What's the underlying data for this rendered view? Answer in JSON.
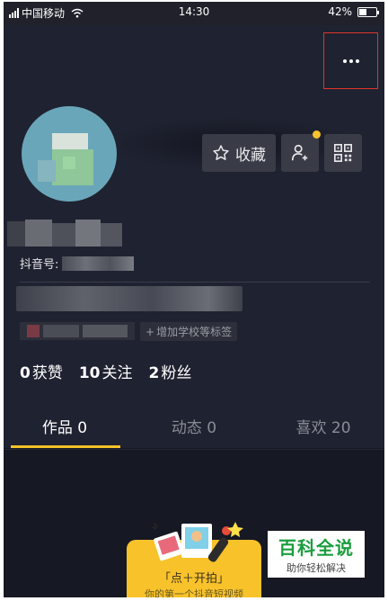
{
  "status_bar": {
    "carrier": "中国移动",
    "time": "14:30",
    "battery_percent": "42%",
    "battery_level": 0.42
  },
  "profile": {
    "uid_label": "抖音号:",
    "collect_label": "收藏",
    "school_tag_label": "增加学校等标签"
  },
  "stats": [
    {
      "value": "0",
      "label": "获赞"
    },
    {
      "value": "10",
      "label": "关注"
    },
    {
      "value": "2",
      "label": "粉丝"
    }
  ],
  "tabs": [
    {
      "label": "作品 0",
      "active": true
    },
    {
      "label": "动态 0",
      "active": false
    },
    {
      "label": "喜欢 20",
      "active": false
    }
  ],
  "promo": {
    "title": "「点＋开拍」",
    "subtitle": "你的第一个抖音短视频"
  },
  "watermark": {
    "title": "百科全说",
    "subtitle": "助你轻松解决"
  },
  "colors": {
    "background": "#161823",
    "accent": "#f8c22a",
    "highlight_box": "#e0342c",
    "watermark_green": "#1a9e3e"
  }
}
